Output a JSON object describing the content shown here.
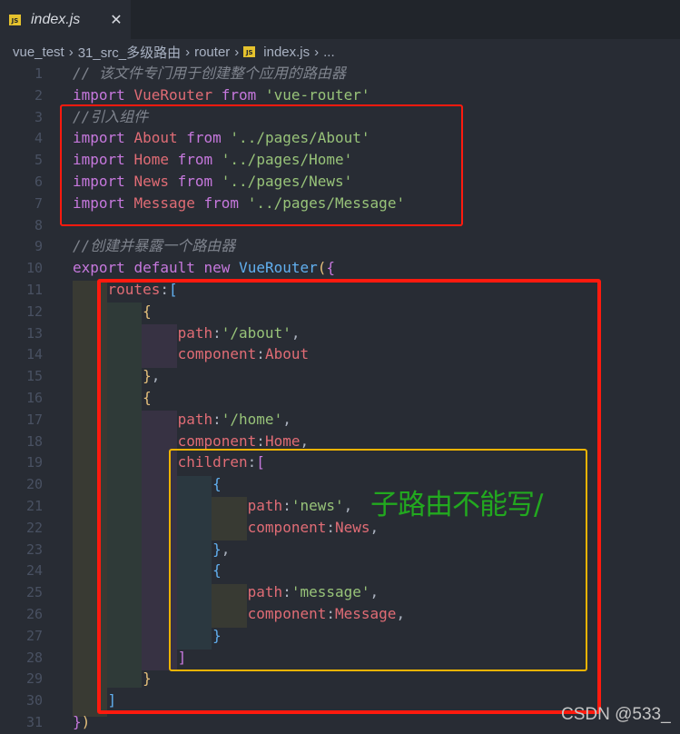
{
  "tab": {
    "icon": "js-file-icon",
    "icon_text": "JS",
    "title": "index.js",
    "close": "✕"
  },
  "breadcrumb": {
    "separator": "›",
    "items": [
      "vue_test",
      "31_src_多级路由",
      "router",
      "index.js",
      "..."
    ]
  },
  "colors": {
    "background": "#282c34",
    "keyword": "#c678dd",
    "identifier": "#e06c75",
    "string": "#98c379",
    "class": "#61afef",
    "comment": "#7f848e",
    "box_red": "#ff1a0e",
    "box_yellow": "#f0b400",
    "annotation": "#22a91f"
  },
  "code": {
    "lines": [
      {
        "n": "1",
        "tokens": [
          [
            "cm",
            "// 该文件专门用于创建整个应用的路由器"
          ]
        ]
      },
      {
        "n": "2",
        "tokens": [
          [
            "kw",
            "import"
          ],
          [
            "pl",
            " "
          ],
          [
            "id",
            "VueRouter"
          ],
          [
            "pl",
            " "
          ],
          [
            "kw",
            "from"
          ],
          [
            "pl",
            " "
          ],
          [
            "str",
            "'vue-router'"
          ]
        ]
      },
      {
        "n": "3",
        "tokens": [
          [
            "cm",
            "//引入组件"
          ]
        ]
      },
      {
        "n": "4",
        "tokens": [
          [
            "kw",
            "import"
          ],
          [
            "pl",
            " "
          ],
          [
            "id",
            "About"
          ],
          [
            "pl",
            " "
          ],
          [
            "kw",
            "from"
          ],
          [
            "pl",
            " "
          ],
          [
            "str",
            "'../pages/About'"
          ]
        ]
      },
      {
        "n": "5",
        "tokens": [
          [
            "kw",
            "import"
          ],
          [
            "pl",
            " "
          ],
          [
            "id",
            "Home"
          ],
          [
            "pl",
            " "
          ],
          [
            "kw",
            "from"
          ],
          [
            "pl",
            " "
          ],
          [
            "str",
            "'../pages/Home'"
          ]
        ]
      },
      {
        "n": "6",
        "tokens": [
          [
            "kw",
            "import"
          ],
          [
            "pl",
            " "
          ],
          [
            "id",
            "News"
          ],
          [
            "pl",
            " "
          ],
          [
            "kw",
            "from"
          ],
          [
            "pl",
            " "
          ],
          [
            "str",
            "'../pages/News'"
          ]
        ]
      },
      {
        "n": "7",
        "tokens": [
          [
            "kw",
            "import"
          ],
          [
            "pl",
            " "
          ],
          [
            "id",
            "Message"
          ],
          [
            "pl",
            " "
          ],
          [
            "kw",
            "from"
          ],
          [
            "pl",
            " "
          ],
          [
            "str",
            "'../pages/Message'"
          ]
        ]
      },
      {
        "n": "8",
        "tokens": []
      },
      {
        "n": "9",
        "tokens": [
          [
            "cm",
            "//创建并暴露一个路由器"
          ]
        ]
      },
      {
        "n": "10",
        "tokens": [
          [
            "kw",
            "export"
          ],
          [
            "pl",
            " "
          ],
          [
            "kw",
            "default"
          ],
          [
            "pl",
            " "
          ],
          [
            "kw",
            "new"
          ],
          [
            "pl",
            " "
          ],
          [
            "cls",
            "VueRouter"
          ],
          [
            "b1",
            "("
          ],
          [
            "b2",
            "{"
          ]
        ]
      },
      {
        "n": "11",
        "tokens": [
          [
            "pl",
            "    "
          ],
          [
            "id",
            "routes"
          ],
          [
            "pl",
            ":"
          ],
          [
            "b3",
            "["
          ]
        ]
      },
      {
        "n": "12",
        "tokens": [
          [
            "pl",
            "        "
          ],
          [
            "b1",
            "{"
          ]
        ]
      },
      {
        "n": "13",
        "tokens": [
          [
            "pl",
            "            "
          ],
          [
            "id",
            "path"
          ],
          [
            "pl",
            ":"
          ],
          [
            "str",
            "'/about'"
          ],
          [
            "pl",
            ","
          ]
        ]
      },
      {
        "n": "14",
        "tokens": [
          [
            "pl",
            "            "
          ],
          [
            "id",
            "component"
          ],
          [
            "pl",
            ":"
          ],
          [
            "id",
            "About"
          ]
        ]
      },
      {
        "n": "15",
        "tokens": [
          [
            "pl",
            "        "
          ],
          [
            "b1",
            "}"
          ],
          [
            "pl",
            ","
          ]
        ]
      },
      {
        "n": "16",
        "tokens": [
          [
            "pl",
            "        "
          ],
          [
            "b1",
            "{"
          ]
        ]
      },
      {
        "n": "17",
        "tokens": [
          [
            "pl",
            "            "
          ],
          [
            "id",
            "path"
          ],
          [
            "pl",
            ":"
          ],
          [
            "str",
            "'/home'"
          ],
          [
            "pl",
            ","
          ]
        ]
      },
      {
        "n": "18",
        "tokens": [
          [
            "pl",
            "            "
          ],
          [
            "id",
            "component"
          ],
          [
            "pl",
            ":"
          ],
          [
            "id",
            "Home"
          ],
          [
            "pl",
            ","
          ]
        ]
      },
      {
        "n": "19",
        "tokens": [
          [
            "pl",
            "            "
          ],
          [
            "id",
            "children"
          ],
          [
            "pl",
            ":"
          ],
          [
            "b2",
            "["
          ]
        ]
      },
      {
        "n": "20",
        "tokens": [
          [
            "pl",
            "                "
          ],
          [
            "b3",
            "{"
          ]
        ]
      },
      {
        "n": "21",
        "tokens": [
          [
            "pl",
            "                    "
          ],
          [
            "id",
            "path"
          ],
          [
            "pl",
            ":"
          ],
          [
            "str",
            "'news'"
          ],
          [
            "pl",
            ","
          ]
        ]
      },
      {
        "n": "22",
        "tokens": [
          [
            "pl",
            "                    "
          ],
          [
            "id",
            "component"
          ],
          [
            "pl",
            ":"
          ],
          [
            "id",
            "News"
          ],
          [
            "pl",
            ","
          ]
        ]
      },
      {
        "n": "23",
        "tokens": [
          [
            "pl",
            "                "
          ],
          [
            "b3",
            "}"
          ],
          [
            "pl",
            ","
          ]
        ]
      },
      {
        "n": "24",
        "tokens": [
          [
            "pl",
            "                "
          ],
          [
            "b3",
            "{"
          ]
        ]
      },
      {
        "n": "25",
        "tokens": [
          [
            "pl",
            "                    "
          ],
          [
            "id",
            "path"
          ],
          [
            "pl",
            ":"
          ],
          [
            "str",
            "'message'"
          ],
          [
            "pl",
            ","
          ]
        ]
      },
      {
        "n": "26",
        "tokens": [
          [
            "pl",
            "                    "
          ],
          [
            "id",
            "component"
          ],
          [
            "pl",
            ":"
          ],
          [
            "id",
            "Message"
          ],
          [
            "pl",
            ","
          ]
        ]
      },
      {
        "n": "27",
        "tokens": [
          [
            "pl",
            "                "
          ],
          [
            "b3",
            "}"
          ]
        ]
      },
      {
        "n": "28",
        "tokens": [
          [
            "pl",
            "            "
          ],
          [
            "b2",
            "]"
          ]
        ]
      },
      {
        "n": "29",
        "tokens": [
          [
            "pl",
            "        "
          ],
          [
            "b1",
            "}"
          ]
        ]
      },
      {
        "n": "30",
        "tokens": [
          [
            "pl",
            "    "
          ],
          [
            "b3",
            "]"
          ]
        ]
      },
      {
        "n": "31",
        "tokens": [
          [
            "b2",
            "}"
          ],
          [
            "b1",
            ")"
          ]
        ]
      }
    ]
  },
  "annotation": {
    "text": "子路由不能写/"
  },
  "watermark": {
    "text": "CSDN @533_"
  }
}
